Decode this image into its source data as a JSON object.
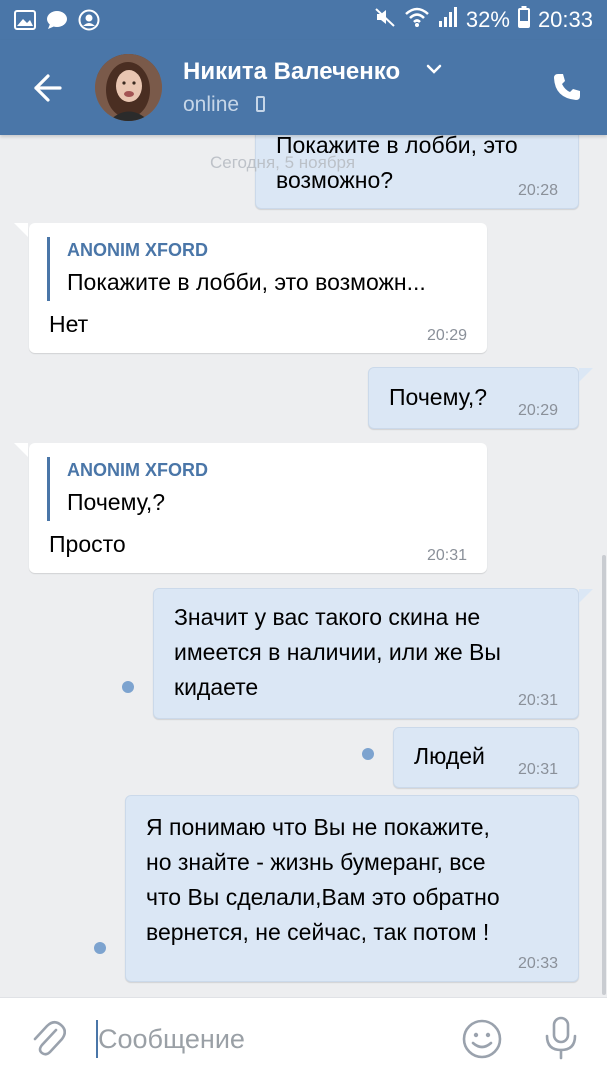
{
  "status_bar": {
    "battery": "32%",
    "time": "20:33"
  },
  "header": {
    "contact_name": "Никита Валеченко",
    "status": "online"
  },
  "chat": {
    "date_divider": "Сегодня, 5 ноября",
    "messages": [
      {
        "direction": "out",
        "text": "Покажите в лобби, это\nвозможно?",
        "time": "20:28"
      },
      {
        "direction": "in",
        "reply_author": "ANONIM XFORD",
        "reply_text": "Покажите в лобби, это возможн...",
        "text": "Нет",
        "time": "20:29"
      },
      {
        "direction": "out",
        "text": "Почему,?",
        "time": "20:29"
      },
      {
        "direction": "in",
        "reply_author": "ANONIM XFORD",
        "reply_text": "Почему,?",
        "text": "Просто",
        "time": "20:31"
      },
      {
        "direction": "out",
        "text": "Значит у вас такого скина не\nимеется в наличии, или же Вы\nкидаете",
        "time": "20:31",
        "unread": true
      },
      {
        "direction": "out",
        "text": "Людей",
        "time": "20:31",
        "unread": true
      },
      {
        "direction": "out",
        "text": "Я понимаю  что Вы не покажите,\nно знайте - жизнь бумеранг, все\nчто Вы сделали,Вам это обратно\nвернется, не сейчас, так потом !",
        "time": "20:33",
        "unread": true
      }
    ]
  },
  "input": {
    "placeholder": "Сообщение"
  },
  "colors": {
    "header": "#4a76a8",
    "chat_bg": "#edeef0",
    "out_bubble": "#dbe7f5",
    "in_bubble": "#ffffff",
    "unread_dot": "#7da3cf"
  },
  "icons": [
    "gallery-icon",
    "chat-icon",
    "account-icon",
    "mute-icon",
    "wifi-icon",
    "signal-icon",
    "battery-icon",
    "back-arrow-icon",
    "chevron-down-icon",
    "phone-device-icon",
    "call-icon",
    "attach-icon",
    "emoji-icon",
    "mic-icon"
  ]
}
